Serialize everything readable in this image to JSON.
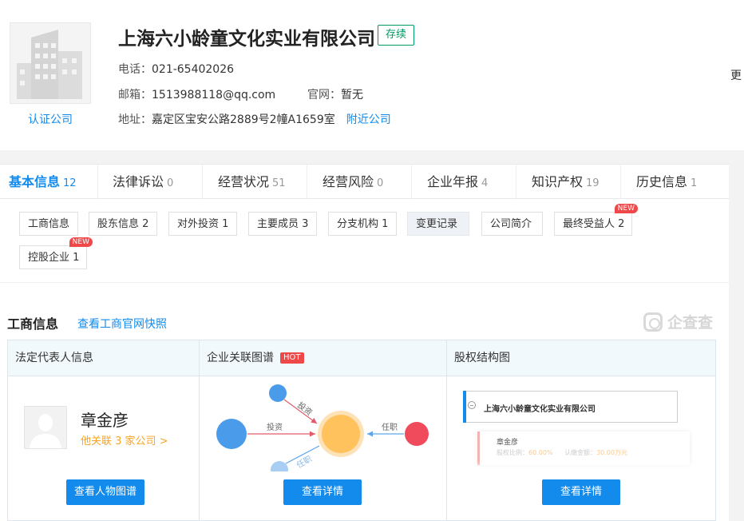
{
  "company": {
    "name": "上海六小龄童文化实业有限公司",
    "status": "存续",
    "certified_label": "认证公司",
    "phone_label": "电话：",
    "phone": "021-65402026",
    "email_label": "邮箱：",
    "email": "1513988118@qq.com",
    "website_label": "官网：",
    "website": "暂无",
    "address_label": "地址：",
    "address": "嘉定区宝安公路2889号2幢A1659室",
    "nearby_link": "附近公司",
    "more_label": "更"
  },
  "tabs": [
    {
      "label": "基本信息",
      "count": "12",
      "active": true
    },
    {
      "label": "法律诉讼",
      "count": "0"
    },
    {
      "label": "经营状况",
      "count": "51"
    },
    {
      "label": "经营风险",
      "count": "0"
    },
    {
      "label": "企业年报",
      "count": "4"
    },
    {
      "label": "知识产权",
      "count": "19"
    },
    {
      "label": "历史信息",
      "count": "1"
    }
  ],
  "subtabs": [
    {
      "label": "工商信息"
    },
    {
      "label": "股东信息 2"
    },
    {
      "label": "对外投资 1"
    },
    {
      "label": "主要成员 3"
    },
    {
      "label": "分支机构 1"
    },
    {
      "label": "变更记录",
      "selected": true
    },
    {
      "label": "公司简介"
    },
    {
      "label": "最终受益人 2",
      "tag": "NEW"
    },
    {
      "label": "控股企业 1",
      "tag": "NEW"
    }
  ],
  "section": {
    "title": "工商信息",
    "link": "查看工商官网快照",
    "watermark": "企查查"
  },
  "cards": {
    "legal_rep": {
      "header": "法定代表人信息",
      "name": "章金彦",
      "relation": "他关联 3 家公司 >",
      "button": "查看人物图谱"
    },
    "graph": {
      "header": "企业关联图谱",
      "hot_tag": "HOT",
      "edge_labels": [
        "投资",
        "投资",
        "任职",
        "任职"
      ],
      "button": "查看详情"
    },
    "equity": {
      "header": "股权结构图",
      "company": "上海六小龄童文化实业有限公司",
      "holder_name": "章金彦",
      "ratio_label": "股权比例：",
      "ratio_value": "60.00%",
      "capital_label": "认缴金额：",
      "capital_value": "30.00万元",
      "button": "查看详情"
    }
  },
  "colors": {
    "accent": "#128bed",
    "status_green": "#009a61",
    "orange": "#f9a425",
    "red": "#ef4848"
  }
}
